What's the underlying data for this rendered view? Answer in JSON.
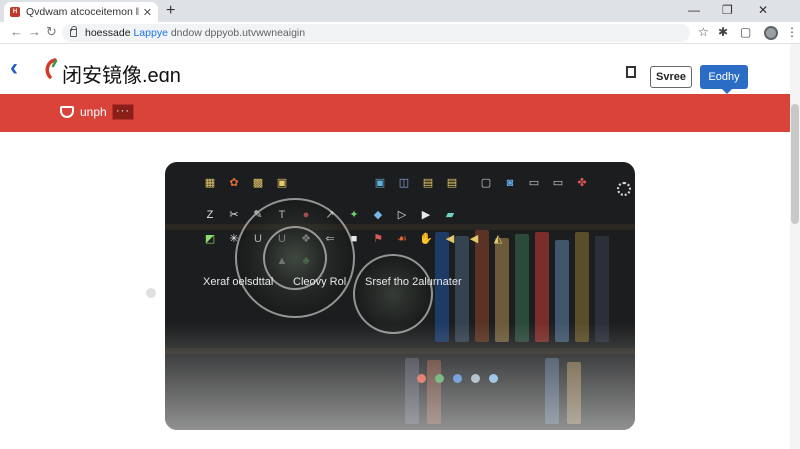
{
  "browser": {
    "tab_title": "Qvdwam atcoceitemon lhuch",
    "tab_favicon": "H",
    "new_tab_label": "+",
    "url_prefix": "hoessade",
    "url_highlight": "Lappye",
    "url_rest": "dndow dppyob.utvwwneaigin",
    "icons": [
      "back-arrow-icon",
      "forward-arrow-icon",
      "refresh-icon",
      "lock-icon",
      "star-icon",
      "extension-icon",
      "sidebar-icon",
      "profile-avatar",
      "kebab-menu-icon"
    ]
  },
  "header": {
    "back_symbol": "‹",
    "site_title": "闭安镜像.eɑn",
    "save_label": "Svree",
    "apply_label": "Eodhy"
  },
  "banner": {
    "label": "unph",
    "more_label": "···",
    "color": "#d9433a"
  },
  "photo": {
    "caption_left": "Xeraf oelsdttal",
    "caption_mid": "Cleovy Rol",
    "caption_right": "Srsef tho 2alurnater"
  },
  "colors": {
    "accent_blue": "#2b6cc4",
    "banner_red": "#d9433a"
  }
}
